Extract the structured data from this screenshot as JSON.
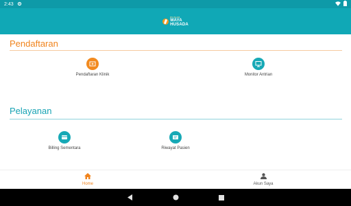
{
  "status_bar": {
    "time": "2:43",
    "settings_icon": "gear-icon",
    "wifi_icon": "wifi-icon",
    "battery_icon": "battery-icon"
  },
  "app_bar": {
    "logo_small": "RS ISLAM",
    "logo_line1": "WAYA",
    "logo_line2": "HUSADA"
  },
  "sections": [
    {
      "title": "Pendaftaran",
      "color": "#f0831c",
      "items": [
        {
          "label": "Pendaftaran Klinik",
          "icon": "register-clinic-icon",
          "color": "#f28a1f"
        },
        {
          "label": "Monitor Antrian",
          "icon": "monitor-icon",
          "color": "#17a9b6"
        }
      ]
    },
    {
      "title": "Pelayanan",
      "color": "#17a3b4",
      "items": [
        {
          "label": "Billing Sementara",
          "icon": "billing-icon",
          "color": "#17a9b6"
        },
        {
          "label": "Riwayat Pasien",
          "icon": "history-icon",
          "color": "#17a9b6"
        }
      ]
    }
  ],
  "bottom_nav": [
    {
      "label": "Home",
      "icon": "home-icon",
      "active": true
    },
    {
      "label": "Akun Saya",
      "icon": "person-icon",
      "active": false
    }
  ],
  "system_nav": {
    "back": "back-icon",
    "home": "home-circle-icon",
    "recents": "recents-icon"
  }
}
